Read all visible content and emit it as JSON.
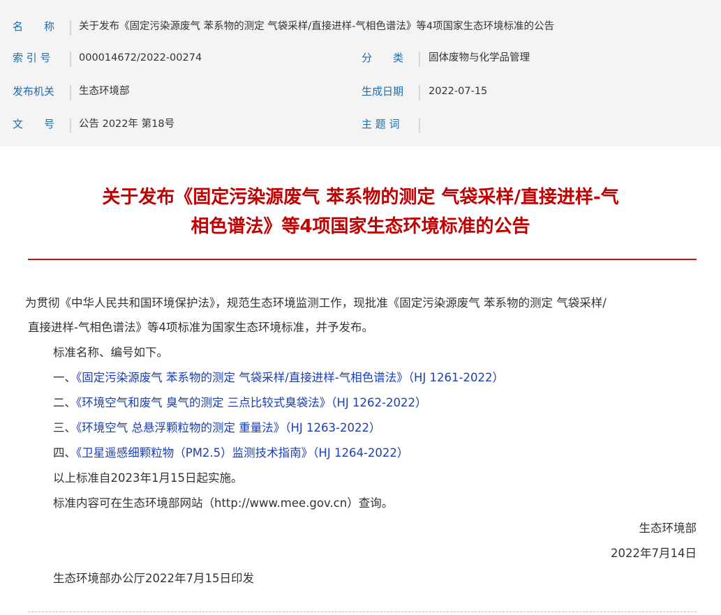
{
  "meta": {
    "name_label": "名　　称",
    "name_value": "关于发布《固定污染源废气 苯系物的测定 气袋采样/直接进样-气相色谱法》等4项国家生态环境标准的公告",
    "index_label": "索 引 号",
    "index_value": "000014672/2022-00274",
    "category_label": "分　　类",
    "category_value": "固体废物与化学品管理",
    "issuer_label": "发布机关",
    "issuer_value": "生态环境部",
    "date_label": "生成日期",
    "date_value": "2022-07-15",
    "docno_label": "文　　号",
    "docno_value": "公告 2022年 第18号",
    "subject_label": "主 题 词",
    "subject_value": ""
  },
  "article": {
    "title_line1": "关于发布《固定污染源废气 苯系物的测定 气袋采样/直接进样-气",
    "title_line2": "相色谱法》等4项国家生态环境标准的公告",
    "para1_line1": "为贯彻《中华人民共和国环境保护法》，规范生态环境监测工作，现批准《固定污染源废气 苯系物的测定 气袋采样/",
    "para1_line2": "直接进样-气相色谱法》等4项标准为国家生态环境标准，并予发布。",
    "para2": "标准名称、编号如下。",
    "items": [
      {
        "num": "一、",
        "link": "《固定污染源废气 苯系物的测定 气袋采样/直接进样-气相色谱法》（HJ 1261-2022）"
      },
      {
        "num": "二、",
        "link": "《环境空气和废气 臭气的测定 三点比较式臭袋法》（HJ 1262-2022）"
      },
      {
        "num": "三、",
        "link": "《环境空气 总悬浮颗粒物的测定 重量法》（HJ 1263-2022）"
      },
      {
        "num": "四、",
        "link": "《卫星遥感细颗粒物（PM2.5）监测技术指南》（HJ 1264-2022）"
      }
    ],
    "para3": "以上标准自2023年1月15日起实施。",
    "para4": "标准内容可在生态环境部网站（http://www.mee.gov.cn）查询。",
    "sign_org": "生态环境部",
    "sign_date": "2022年7月14日",
    "footer": "生态环境部办公厅2022年7月15日印发"
  }
}
